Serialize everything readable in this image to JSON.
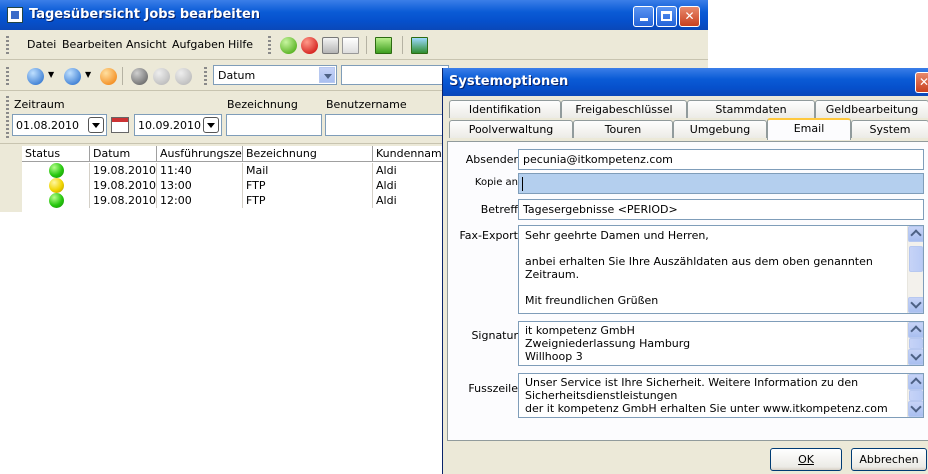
{
  "main_window": {
    "title": "Tagesübersicht Jobs bearbeiten",
    "menu": [
      "Datei",
      "Bearbeiten",
      "Ansicht",
      "Aufgaben",
      "Hilfe"
    ],
    "toolbar_select": "Datum",
    "filter": {
      "zeitraum_label": "Zeitraum",
      "date_from": "01.08.2010",
      "date_to": "10.09.2010",
      "bezeichnung_label": "Bezeichnung",
      "benutzername_label": "Benutzername"
    },
    "grid": {
      "columns": [
        "Status",
        "Datum",
        "Ausführungszeit",
        "Bezeichnung",
        "Kundenname"
      ],
      "rows": [
        {
          "status": "green",
          "datum": "19.08.2010",
          "zeit": "11:40",
          "bezeichnung": "Mail",
          "kunde": "Aldi"
        },
        {
          "status": "yellow",
          "datum": "19.08.2010",
          "zeit": "13:00",
          "bezeichnung": "FTP",
          "kunde": "Aldi"
        },
        {
          "status": "green",
          "datum": "19.08.2010",
          "zeit": "12:00",
          "bezeichnung": "FTP",
          "kunde": "Aldi"
        }
      ]
    },
    "colors": {
      "title_blue": "#0a5bd6",
      "status_green": "#27c70f",
      "status_yellow": "#f0d400"
    }
  },
  "dialog": {
    "title": "Systemoptionen",
    "tabs_row1": [
      "Identifikation",
      "Freigabeschlüssel",
      "Stammdaten",
      "Geldbearbeitung"
    ],
    "tabs_row2": [
      "Poolverwaltung",
      "Touren",
      "Umgebung",
      "Email",
      "System"
    ],
    "active_tab": "Email",
    "fields": {
      "absender_label": "Absender",
      "absender_value": "pecunia@itkompetenz.com",
      "kopie_label": "Kopie an",
      "kopie_value": "",
      "betreff_label": "Betreff",
      "betreff_value": "Tagesergebnisse <PERIOD>",
      "faxexport_label": "Fax-Export",
      "faxexport_lines": [
        "Sehr geehrte Damen und Herren,",
        "",
        "anbei erhalten Sie Ihre Auszähldaten aus dem oben genannten",
        "Zeitraum.",
        "",
        "Mit freundlichen Grüßen"
      ],
      "signatur_label": "Signatur",
      "signatur_lines": [
        "it kompetenz GmbH",
        "Zweigniederlassung Hamburg",
        "Willhoop 3"
      ],
      "fusszeile_label": "Fusszeile",
      "fusszeile_lines": [
        "Unser Service ist Ihre Sicherheit. Weitere Information zu den",
        "Sicherheitsdienstleistungen",
        "der it kompetenz GmbH erhalten Sie unter www.itkompetenz.com"
      ]
    },
    "buttons": {
      "ok": "OK",
      "cancel": "Abbrechen"
    }
  }
}
